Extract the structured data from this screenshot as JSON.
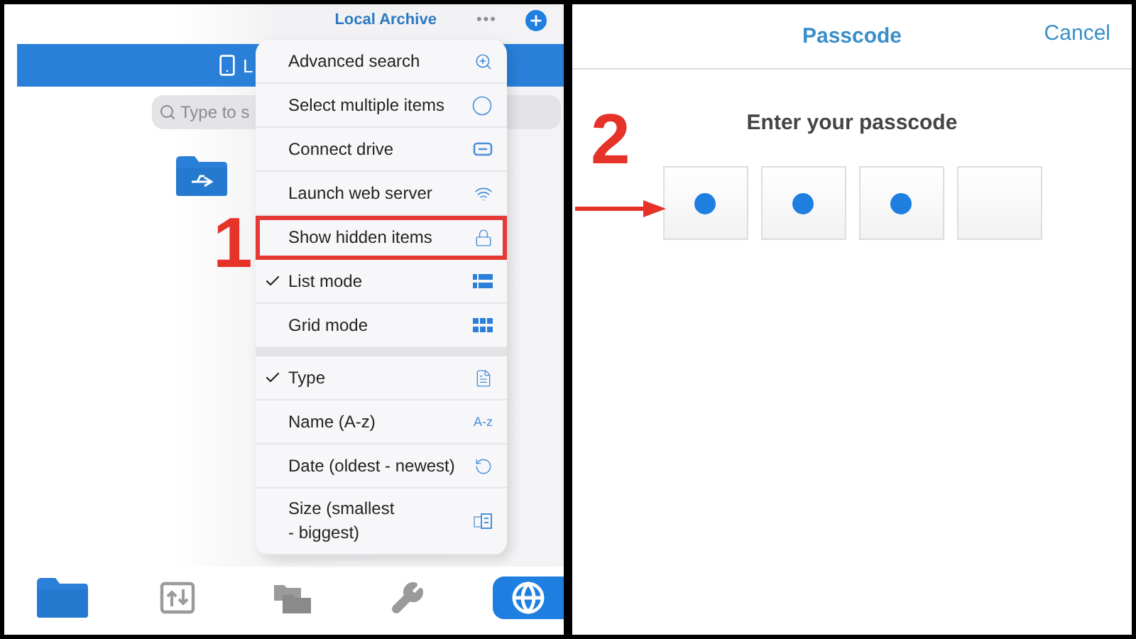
{
  "file_screen": {
    "title": "Local Archive",
    "more": "•••",
    "location_tab": "L",
    "search": {
      "placeholder": "Type to s"
    },
    "menu": {
      "sections": [
        {
          "items": [
            {
              "label": "Advanced search",
              "checked": false,
              "highlighted": false
            },
            {
              "label": "Select multiple items",
              "checked": false,
              "highlighted": false
            },
            {
              "label": "Connect drive",
              "checked": false,
              "highlighted": false
            },
            {
              "label": "Launch web server",
              "checked": false,
              "highlighted": false
            },
            {
              "label": "Show hidden items",
              "checked": false,
              "highlighted": true
            },
            {
              "label": "List mode",
              "checked": true,
              "highlighted": false
            },
            {
              "label": "Grid mode",
              "checked": false,
              "highlighted": false
            }
          ]
        },
        {
          "items": [
            {
              "label": "Type",
              "checked": true,
              "highlighted": false
            },
            {
              "label": "Name (A-z)",
              "checked": false,
              "highlighted": false,
              "icon_text": "A-z"
            },
            {
              "label": "Date (oldest - newest)",
              "checked": false,
              "highlighted": false
            },
            {
              "label": "Size (smallest\n- biggest)",
              "checked": false,
              "highlighted": false
            }
          ]
        }
      ]
    },
    "tab_bar": [
      {
        "selected": false
      },
      {
        "selected": false
      },
      {
        "selected": false
      },
      {
        "selected": false
      },
      {
        "selected": true
      }
    ],
    "step": "1"
  },
  "passcode_screen": {
    "title": "Passcode",
    "cancel": "Cancel",
    "prompt": "Enter your passcode",
    "digits": [
      {
        "filled": true
      },
      {
        "filled": true
      },
      {
        "filled": true
      },
      {
        "filled": false
      }
    ],
    "step": "2"
  }
}
